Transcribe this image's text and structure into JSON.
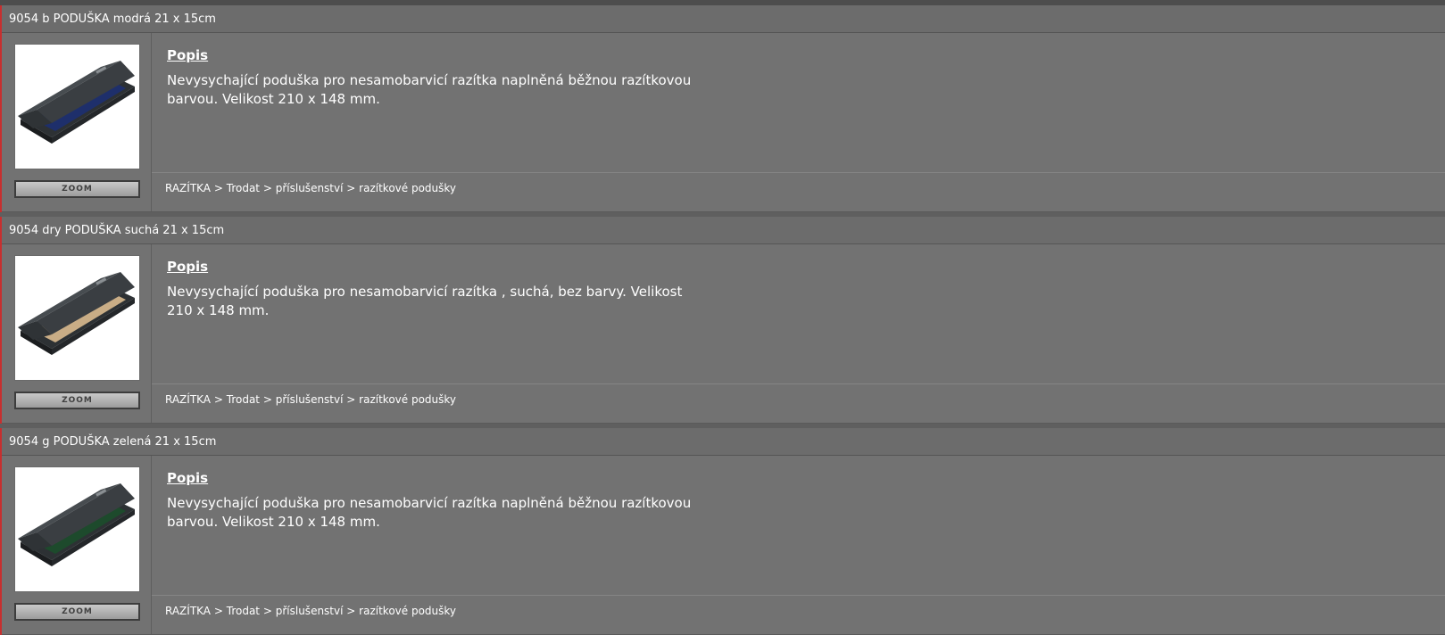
{
  "products": [
    {
      "title": "9054 b PODUŠKA modrá 21 x 15cm",
      "image_alt": "ink pad with blue ink",
      "pad_color": "#1e2f6b",
      "zoom_label": "ZOOM",
      "popis_label": "Popis",
      "description": "Nevysychající poduška pro nesamobarvicí razítka naplněná běžnou razítkovou barvou. Velikost 210 x 148 mm.",
      "breadcrumb": [
        "RAZÍTKA",
        "Trodat",
        "příslušenství",
        "razítkové podušky"
      ]
    },
    {
      "title": "9054 dry PODUŠKA suchá 21 x 15cm",
      "image_alt": "dry ink pad",
      "pad_color": "#c9ad86",
      "zoom_label": "ZOOM",
      "popis_label": "Popis",
      "description": "Nevysychající poduška pro nesamobarvicí razítka , suchá, bez barvy. Velikost 210 x 148 mm.",
      "breadcrumb": [
        "RAZÍTKA",
        "Trodat",
        "příslušenství",
        "razítkové podušky"
      ]
    },
    {
      "title": "9054 g PODUŠKA zelená 21 x 15cm",
      "image_alt": "ink pad with green ink",
      "pad_color": "#1d4a2c",
      "zoom_label": "ZOOM",
      "popis_label": "Popis",
      "description": "Nevysychající poduška pro nesamobarvicí razítka naplněná běžnou razítkovou barvou. Velikost 210 x 148 mm.",
      "breadcrumb": [
        "RAZÍTKA",
        "Trodat",
        "příslušenství",
        "razítkové podušky"
      ]
    }
  ],
  "breadcrumb_separator": ">"
}
